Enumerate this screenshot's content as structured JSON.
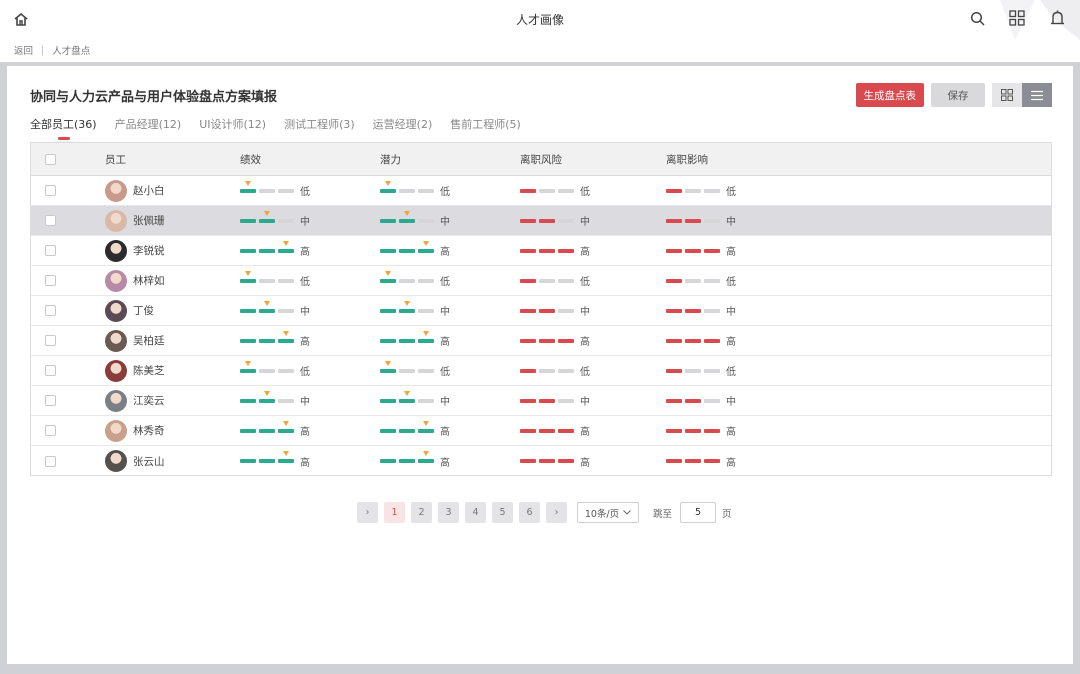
{
  "header": {
    "title": "人才画像",
    "breadcrumb": {
      "back": "返回",
      "current": "人才盘点"
    }
  },
  "page": {
    "title": "协同与人力云产品与用户体验盘点方案填报",
    "generate_label": "生成盘点表",
    "save_label": "保存"
  },
  "tabs": [
    {
      "label": "全部员工(36)",
      "active": true
    },
    {
      "label": "产品经理(12)"
    },
    {
      "label": "UI设计师(12)"
    },
    {
      "label": "测试工程师(3)"
    },
    {
      "label": "运营经理(2)"
    },
    {
      "label": "售前工程师(5)"
    }
  ],
  "table": {
    "columns": [
      "员工",
      "绩效",
      "潜力",
      "离职风险",
      "离职影响"
    ],
    "rows": [
      {
        "name": "赵小白",
        "perf": "低",
        "potential": "低",
        "risk": "低",
        "impact": "低",
        "avatar": "#c99a8c",
        "selected": false
      },
      {
        "name": "张佩珊",
        "perf": "中",
        "potential": "中",
        "risk": "中",
        "impact": "中",
        "avatar": "#d9b8a8",
        "selected": true
      },
      {
        "name": "李锐锐",
        "perf": "高",
        "potential": "高",
        "risk": "高",
        "impact": "高",
        "avatar": "#2b2b2e",
        "selected": false
      },
      {
        "name": "林梓如",
        "perf": "低",
        "potential": "低",
        "risk": "低",
        "impact": "低",
        "avatar": "#b78aa6",
        "selected": false
      },
      {
        "name": "丁俊",
        "perf": "中",
        "potential": "中",
        "risk": "中",
        "impact": "中",
        "avatar": "#5b4a55",
        "selected": false
      },
      {
        "name": "吴柏廷",
        "perf": "高",
        "potential": "高",
        "risk": "高",
        "impact": "高",
        "avatar": "#6a5a52",
        "selected": false
      },
      {
        "name": "陈美芝",
        "perf": "低",
        "potential": "低",
        "risk": "低",
        "impact": "低",
        "avatar": "#8c3b3b",
        "selected": false
      },
      {
        "name": "江奕云",
        "perf": "中",
        "potential": "中",
        "risk": "中",
        "impact": "中",
        "avatar": "#7b7f86",
        "selected": false
      },
      {
        "name": "林秀奇",
        "perf": "高",
        "potential": "高",
        "risk": "高",
        "impact": "高",
        "avatar": "#c8a08c",
        "selected": false
      },
      {
        "name": "张云山",
        "perf": "高",
        "potential": "高",
        "risk": "高",
        "impact": "高",
        "avatar": "#54504e",
        "selected": false
      }
    ]
  },
  "pagination": {
    "prev": "›",
    "pages": [
      "1",
      "2",
      "3",
      "4",
      "5",
      "6"
    ],
    "current_page": "1",
    "next": "›",
    "page_size": "10条/页",
    "jump_label": "跳至",
    "jump_value": "5",
    "page_unit": "页"
  },
  "colors": {
    "accent": "#d94a4f",
    "good": "#2aab8f",
    "risk": "#d94a4f",
    "marker": "#f0a43a"
  }
}
